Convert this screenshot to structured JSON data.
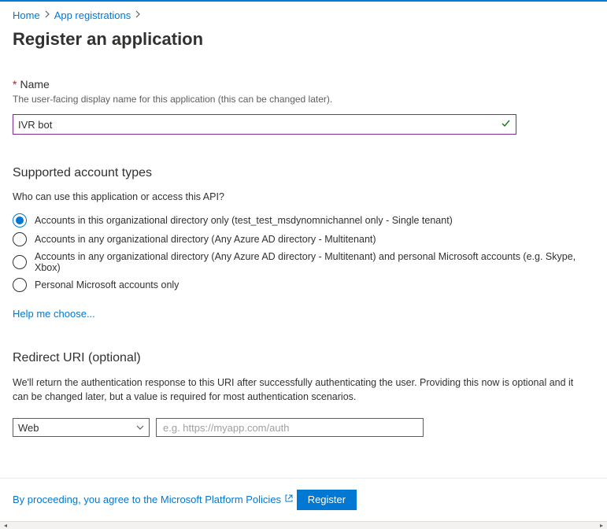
{
  "breadcrumb": {
    "home": "Home",
    "app_registrations": "App registrations"
  },
  "page_title": "Register an application",
  "name_section": {
    "required_mark": "*",
    "label": "Name",
    "help": "The user-facing display name for this application (this can be changed later).",
    "value": "IVR bot"
  },
  "account_types": {
    "heading": "Supported account types",
    "question": "Who can use this application or access this API?",
    "options": [
      "Accounts in this organizational directory only (test_test_msdynomnichannel only - Single tenant)",
      "Accounts in any organizational directory (Any Azure AD directory - Multitenant)",
      "Accounts in any organizational directory (Any Azure AD directory - Multitenant) and personal Microsoft accounts (e.g. Skype, Xbox)",
      "Personal Microsoft accounts only"
    ],
    "selected_index": 0,
    "help_link": "Help me choose..."
  },
  "redirect": {
    "heading": "Redirect URI (optional)",
    "description": "We'll return the authentication response to this URI after successfully authenticating the user. Providing this now is optional and it can be changed later, but a value is required for most authentication scenarios.",
    "platform_selected": "Web",
    "uri_placeholder": "e.g. https://myapp.com/auth"
  },
  "footer": {
    "policy_text": "By proceeding, you agree to the Microsoft Platform Policies",
    "register_label": "Register"
  }
}
